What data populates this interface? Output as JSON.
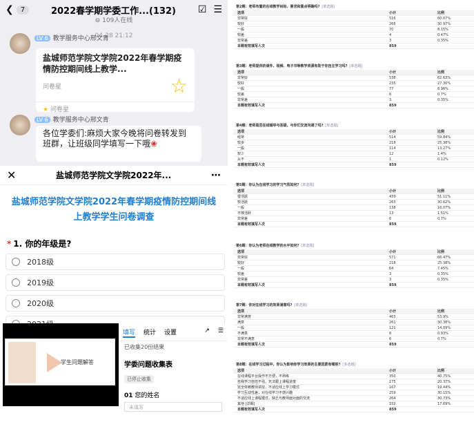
{
  "chat": {
    "back_count": "7",
    "title": "2022春学期学委工作...(132)",
    "online": "109人在线",
    "time": "04-28 21:12",
    "msg1": {
      "lv": "LV 6",
      "sender": "教学服务中心邢文青",
      "card_title": "盐城师范学院文学院2022年春学期疫情防控期间线上教学...",
      "card_from": "问卷星",
      "card_footer": "问卷星"
    },
    "msg2": {
      "lv": "LV 6",
      "sender": "教学服务中心邢文青",
      "text": "各位学委们:麻烦大家今晚将问卷转发到班群，让班级同学填写一下哦"
    }
  },
  "survey": {
    "header_title": "盐城师范学院文学院2022年...",
    "title": "盐城师范学院文学院2022年春学期疫情防控期间线上教学学生问卷调查",
    "q1": "1. 你的年级是?",
    "options": [
      "2018级",
      "2019级",
      "2020级",
      "2021级"
    ]
  },
  "video": {
    "slide_text": "学生问题解答"
  },
  "form": {
    "tabs": [
      "填写",
      "统计",
      "设置"
    ],
    "count": "已收集20份结果",
    "title": "学委问题收集表",
    "status": "已停止收集",
    "q_num": "01",
    "q_label": "您的姓名",
    "placeholder": "未填写"
  },
  "results": {
    "col_option": "选项",
    "col_count": "小计",
    "col_ratio": "比例",
    "footer": "本题有效填写人次",
    "questions": [
      {
        "title": "第2题：老师布置的在线教学目标、要求和重点明确吗?",
        "type": "[单选题]",
        "rows": [
          [
            "非常好",
            "516",
            "60.07%"
          ],
          [
            "较好",
            "266",
            "30.97%"
          ],
          [
            "一般",
            "70",
            "8.15%"
          ],
          [
            "较差",
            "4",
            "0.47%"
          ],
          [
            "非常差",
            "3",
            "0.35%"
          ]
        ],
        "total": "859"
      },
      {
        "title": "第3题：老师提供的课件、视频、电子书等教学资源有助于你自主学习吗?",
        "type": "[单选题]",
        "rows": [
          [
            "非常好",
            "538",
            "62.63%"
          ],
          [
            "较好",
            "235",
            "27.36%"
          ],
          [
            "一般",
            "77",
            "8.96%"
          ],
          [
            "较差",
            "6",
            "0.7%"
          ],
          [
            "非常差",
            "3",
            "0.35%"
          ]
        ],
        "total": "859"
      },
      {
        "title": "第4题：老师是否在线辅导与答疑，与你们交流沟通了吗?",
        "type": "[单选题]",
        "rows": [
          [
            "经常",
            "514",
            "59.84%"
          ],
          [
            "较多",
            "218",
            "25.38%"
          ],
          [
            "一般",
            "114",
            "13.27%"
          ],
          [
            "较少",
            "12",
            "1.4%"
          ],
          [
            "从不",
            "1",
            "0.12%"
          ]
        ],
        "total": "859"
      },
      {
        "title": "第5题：你认为在线学习的学习气氛如何?",
        "type": "[单选题]",
        "rows": [
          [
            "很活跃",
            "439",
            "51.11%"
          ],
          [
            "较活跃",
            "263",
            "30.62%"
          ],
          [
            "一般",
            "138",
            "16.07%"
          ],
          [
            "不够活跃",
            "13",
            "1.51%"
          ],
          [
            "非常差",
            "6",
            "0.7%"
          ]
        ],
        "total": "859"
      },
      {
        "title": "第6题：你认为老师在线教学的水平如何?",
        "type": "[单选题]",
        "rows": [
          [
            "非常好",
            "571",
            "66.47%"
          ],
          [
            "较好",
            "218",
            "25.38%"
          ],
          [
            "一般",
            "64",
            "7.45%"
          ],
          [
            "较差",
            "3",
            "0.35%"
          ],
          [
            "非常差",
            "3",
            "0.35%"
          ]
        ],
        "total": "859"
      },
      {
        "title": "第7题：你对在线学习的效果满意吗?",
        "type": "[单选题]",
        "rows": [
          [
            "非常满意",
            "463",
            "53.9%"
          ],
          [
            "满意",
            "261",
            "30.38%"
          ],
          [
            "一般",
            "121",
            "14.09%"
          ],
          [
            "不满意",
            "8",
            "0.93%"
          ],
          [
            "非常不满意",
            "6",
            "0.7%"
          ]
        ],
        "total": "859"
      },
      {
        "title": "第8题：在线学习过程中，你认为影响你学习效果的主要因素有哪些?",
        "type": "[多选题]",
        "rows": [
          [
            "在线课程平台操作不方便，不熟练",
            "350",
            "40.75%"
          ],
          [
            "自我学习自控不强，无法跟上课程进度",
            "175",
            "20.37%"
          ],
          [
            "完全依赖教师讲授，不适应线上学习模式",
            "167",
            "19.44%"
          ],
          [
            "学习互动性差，对在线学习不感兴趣",
            "259",
            "30.15%"
          ],
          [
            "不适应线上课程模式，缺乏与教师面对面的交流",
            "264",
            "30.73%"
          ],
          [
            "其他 [详细]",
            "152",
            "17.69%"
          ]
        ],
        "total": "859"
      }
    ]
  }
}
